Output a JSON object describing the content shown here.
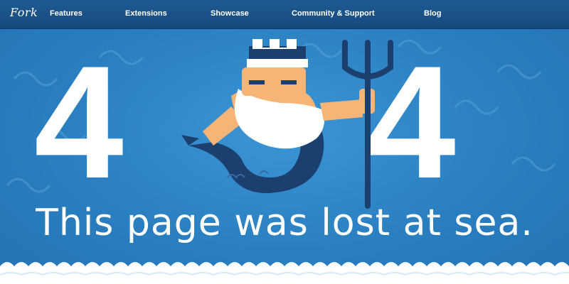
{
  "nav": {
    "brand": "Fork",
    "links": [
      "Features",
      "Extensions",
      "Showcase",
      "Community & Support",
      "Blog"
    ]
  },
  "hero": {
    "digit_left": "4",
    "digit_right": "4",
    "message": "This page was lost at sea."
  },
  "colors": {
    "navbar": "#1b548a",
    "sea": "#2f86c8",
    "navy": "#1b3f6e",
    "foam": "#ffffff",
    "skin": "#f6b577"
  }
}
